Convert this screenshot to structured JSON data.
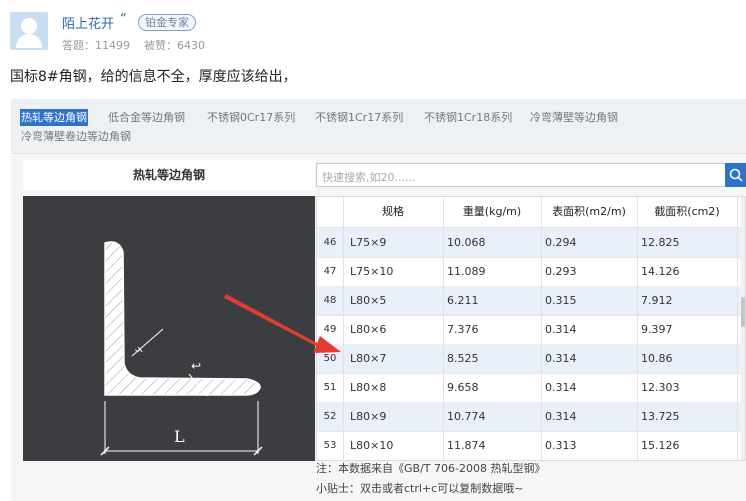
{
  "user": {
    "name": "陌上花开",
    "quote_mark": "“",
    "badge": "铂金专家",
    "stats": "答题：11499    被赞：6430"
  },
  "answer": "国标8#角钢，给的信息不全，厚度应该给出，",
  "screenshot": {
    "tabs": [
      "热轧等边角钢",
      "低合金等边角钢",
      "不锈钢0Cr17系列",
      "不锈钢1Cr17系列",
      "不锈钢1Cr18系列",
      "冷弯薄壁等边角钢",
      "冷弯薄壁卷边等边角钢"
    ],
    "left_title": "热轧等边角钢",
    "diagram_label": "L",
    "search_placeholder": "快速搜索,如20......",
    "table": {
      "headers": [
        "规格",
        "重量(kg/m)",
        "表面积(m2/m)",
        "截面积(cm2)"
      ],
      "rows": [
        {
          "n": "46",
          "spec": "L75×9",
          "weight": "10.068",
          "surface": "0.294",
          "section": "12.825"
        },
        {
          "n": "47",
          "spec": "L75×10",
          "weight": "11.089",
          "surface": "0.293",
          "section": "14.126"
        },
        {
          "n": "48",
          "spec": "L80×5",
          "weight": "6.211",
          "surface": "0.315",
          "section": "7.912"
        },
        {
          "n": "49",
          "spec": "L80×6",
          "weight": "7.376",
          "surface": "0.314",
          "section": "9.397"
        },
        {
          "n": "50",
          "spec": "L80×7",
          "weight": "8.525",
          "surface": "0.314",
          "section": "10.86"
        },
        {
          "n": "51",
          "spec": "L80×8",
          "weight": "9.658",
          "surface": "0.314",
          "section": "12.303"
        },
        {
          "n": "52",
          "spec": "L80×9",
          "weight": "10.774",
          "surface": "0.314",
          "section": "13.725"
        },
        {
          "n": "53",
          "spec": "L80×10",
          "weight": "11.874",
          "surface": "0.313",
          "section": "15.126"
        }
      ]
    },
    "note": "注：本数据来自《GB/T 706-2008 热轧型钢》",
    "tip": "小贴士：双击或者ctrl+c可以复制数据哦~"
  },
  "colors": {
    "accent": "#2e73c8",
    "row_highlight": "#eaf0fa",
    "diagram_bg": "#3b3d40",
    "arrow": "#e03c32"
  }
}
